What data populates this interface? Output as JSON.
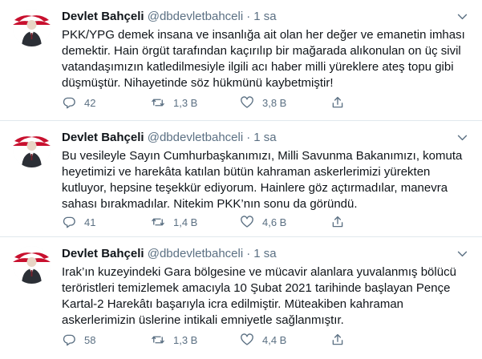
{
  "tweets": [
    {
      "author": "Devlet Bahçeli",
      "handle": "@dbdevletbahceli",
      "separator": "·",
      "time": "1 sa",
      "lines": [
        "PKK/YPG demek insana ve insanlığa ait olan her değer ve emanetin imhası",
        "demektir. Hain örgüt tarafından kaçırılıp bir mağarada alıkonulan on üç sivil",
        "vatandaşımızın katledilmesiyle ilgili acı haber milli yüreklere ateş topu gibi",
        "düşmüştür. Nihayetinde söz hükmünü kaybetmiştir!"
      ],
      "replies": "42",
      "retweets": "1,3 B",
      "likes": "3,8 B"
    },
    {
      "author": "Devlet Bahçeli",
      "handle": "@dbdevletbahceli",
      "separator": "·",
      "time": "1 sa",
      "lines": [
        "Bu vesileyle Sayın Cumhurbaşkanımızı, Milli Savunma Bakanımızı, komuta",
        "heyetimizi ve harekâta katılan bütün kahraman askerlerimizi yürekten",
        "kutluyor, hepsine teşekkür ediyorum. Hainlere göz açtırmadılar, manevra",
        "sahası bırakmadılar. Nitekim PKK’nın sonu da göründü."
      ],
      "replies": "41",
      "retweets": "1,4 B",
      "likes": "4,6 B"
    },
    {
      "author": "Devlet Bahçeli",
      "handle": "@dbdevletbahceli",
      "separator": "·",
      "time": "1 sa",
      "lines": [
        "Irak’ın kuzeyindeki Gara bölgesine ve mücavir alanlara yuvalanmış bölücü",
        "teröristleri temizlemek amacıyla 10 Şubat 2021 tarihinde başlayan Pençe",
        "Kartal-2 Harekâtı başarıyla icra edilmiştir. Müteakiben kahraman",
        "askerlerimizin üslerine intikali emniyetle sağlanmıştır."
      ],
      "replies": "58",
      "retweets": "1,3 B",
      "likes": "4,4 B"
    }
  ],
  "icons": {
    "reply": "reply-icon",
    "retweet": "retweet-icon",
    "like": "heart-icon",
    "share": "share-icon",
    "more": "chevron-down-icon"
  },
  "colors": {
    "text": "#0f1419",
    "muted": "#5b7083",
    "divider": "#e1e8ed",
    "avatar_accent": "#c8102e"
  }
}
